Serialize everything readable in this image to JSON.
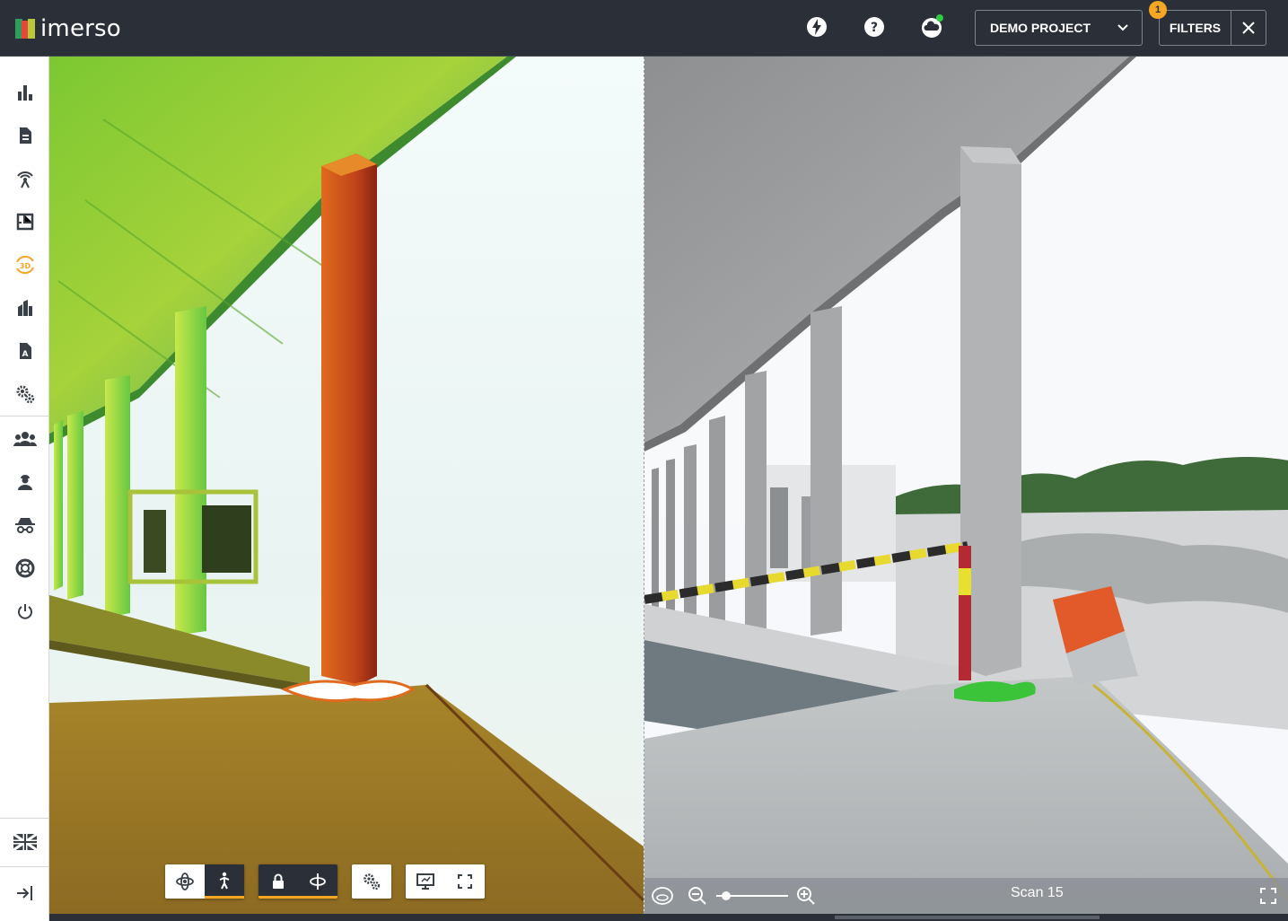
{
  "app": {
    "brand": "imerso"
  },
  "header": {
    "project_select": {
      "value": "DEMO PROJECT"
    },
    "filters": {
      "label": "FILTERS",
      "badge_count": "1"
    },
    "icons": [
      "bolt-icon",
      "help-icon",
      "cloud-status-icon"
    ],
    "status_dot_color": "#2ecc40"
  },
  "sidebar": {
    "items": [
      {
        "name": "dashboard",
        "icon": "bar-chart-icon"
      },
      {
        "name": "documents",
        "icon": "document-icon"
      },
      {
        "name": "scans",
        "icon": "scanner-icon"
      },
      {
        "name": "floorplan",
        "icon": "floorplan-icon"
      },
      {
        "name": "3d-viewer",
        "icon": "3d-rotate-icon",
        "active": true,
        "label": "3D"
      },
      {
        "name": "buildings",
        "icon": "building-icon"
      },
      {
        "name": "reports",
        "icon": "report-icon"
      },
      {
        "name": "settings",
        "icon": "gears-icon"
      },
      {
        "name": "team",
        "icon": "group-icon"
      },
      {
        "name": "users",
        "icon": "worker-icon"
      },
      {
        "name": "spy",
        "icon": "incognito-icon"
      },
      {
        "name": "support",
        "icon": "lifebuoy-icon"
      },
      {
        "name": "logout",
        "icon": "power-icon"
      }
    ],
    "language": "uk-flag-icon",
    "collapse": "collapse-icon"
  },
  "viewer_toolbar": {
    "groups": [
      [
        "orbit-icon",
        "walk-icon"
      ],
      [
        "lock-icon",
        "rotate-axis-icon"
      ],
      [
        "settings-icon"
      ],
      [
        "screen-icon",
        "fullscreen-icon"
      ]
    ]
  },
  "photo_viewer": {
    "scan_label": "Scan 15",
    "zoom_level": 0.14
  },
  "colors": {
    "accent": "#f5a623",
    "topbar": "#2b3038"
  }
}
